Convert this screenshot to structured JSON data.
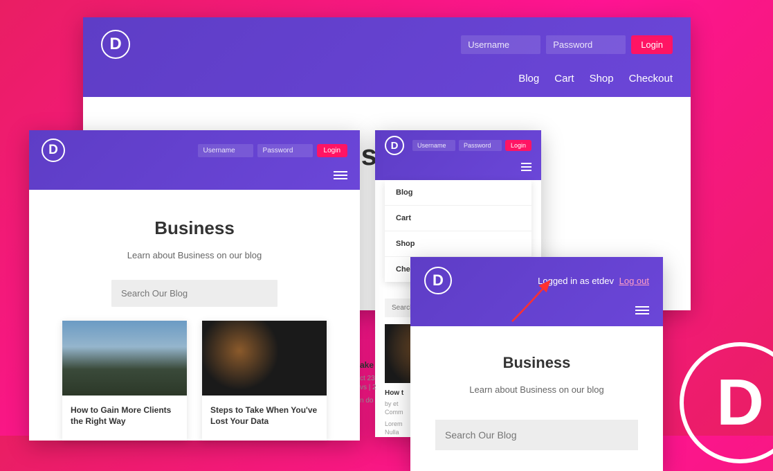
{
  "logo_letter": "D",
  "auth": {
    "username_placeholder": "Username",
    "password_placeholder": "Password",
    "login_label": "Login"
  },
  "nav": {
    "blog": "Blog",
    "cart": "Cart",
    "shop": "Shop",
    "checkout": "Checkout"
  },
  "page": {
    "title": "Business",
    "subtitle": "Learn about Business on our blog",
    "search_placeholder": "Search Our Blog"
  },
  "posts": {
    "card1": "How to Gain More Clients the Right Way",
    "card2": "Steps to Take When You've Lost Your Data",
    "clip_title": "How t",
    "clip_take": "ake",
    "clip_meta1": "ct 23",
    "clip_meta2": "vs | 2",
    "clip_meta3": "n do",
    "snip_by": "by et",
    "snip_com": "Comm",
    "snip_l1": "Lorem",
    "snip_l2": "Nulla"
  },
  "logged_in": {
    "text": "Logged in as etdev",
    "logout": "Log out"
  }
}
